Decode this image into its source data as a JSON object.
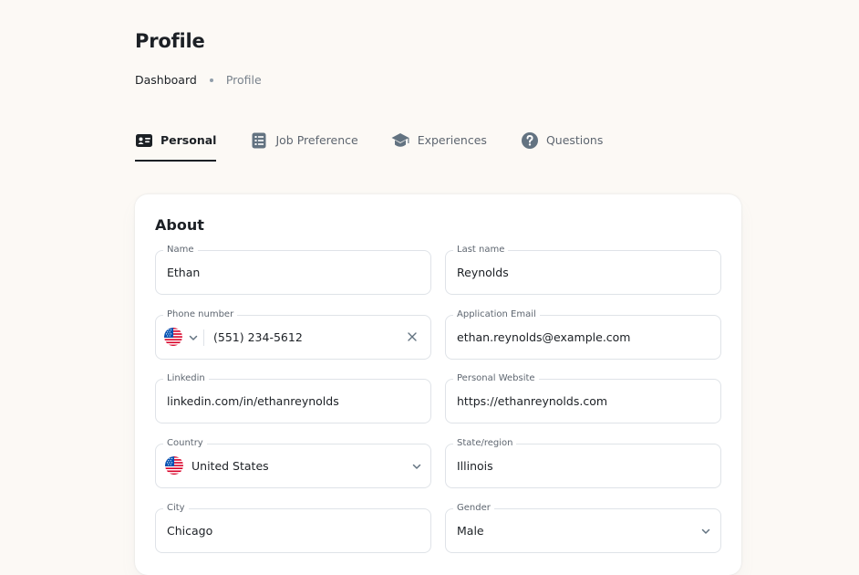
{
  "page": {
    "title": "Profile"
  },
  "breadcrumb": {
    "items": [
      "Dashboard",
      "Profile"
    ]
  },
  "tabs": [
    {
      "label": "Personal",
      "icon": "id-card-icon",
      "active": true
    },
    {
      "label": "Job Preference",
      "icon": "list-icon",
      "active": false
    },
    {
      "label": "Experiences",
      "icon": "graduation-cap-icon",
      "active": false
    },
    {
      "label": "Questions",
      "icon": "question-circle-icon",
      "active": false
    }
  ],
  "about": {
    "title": "About",
    "fields": {
      "name": {
        "label": "Name",
        "value": "Ethan"
      },
      "last_name": {
        "label": "Last name",
        "value": "Reynolds"
      },
      "phone": {
        "label": "Phone number",
        "value": "(551) 234-5612",
        "country_flag": "us-flag-icon"
      },
      "email": {
        "label": "Application Email",
        "value": "ethan.reynolds@example.com"
      },
      "linkedin": {
        "label": "Linkedin",
        "value": "linkedin.com/in/ethanreynolds"
      },
      "website": {
        "label": "Personal Website",
        "value": "https://ethanreynolds.com"
      },
      "country": {
        "label": "Country",
        "value": "United States",
        "flag": "us-flag-icon"
      },
      "state": {
        "label": "State/region",
        "value": "Illinois"
      },
      "city": {
        "label": "City",
        "value": "Chicago"
      },
      "gender": {
        "label": "Gender",
        "value": "Male"
      }
    }
  },
  "colors": {
    "background": "#fcf9f5",
    "text": "#1c2025",
    "muted": "#7a838d",
    "border": "#dfe3e8"
  }
}
